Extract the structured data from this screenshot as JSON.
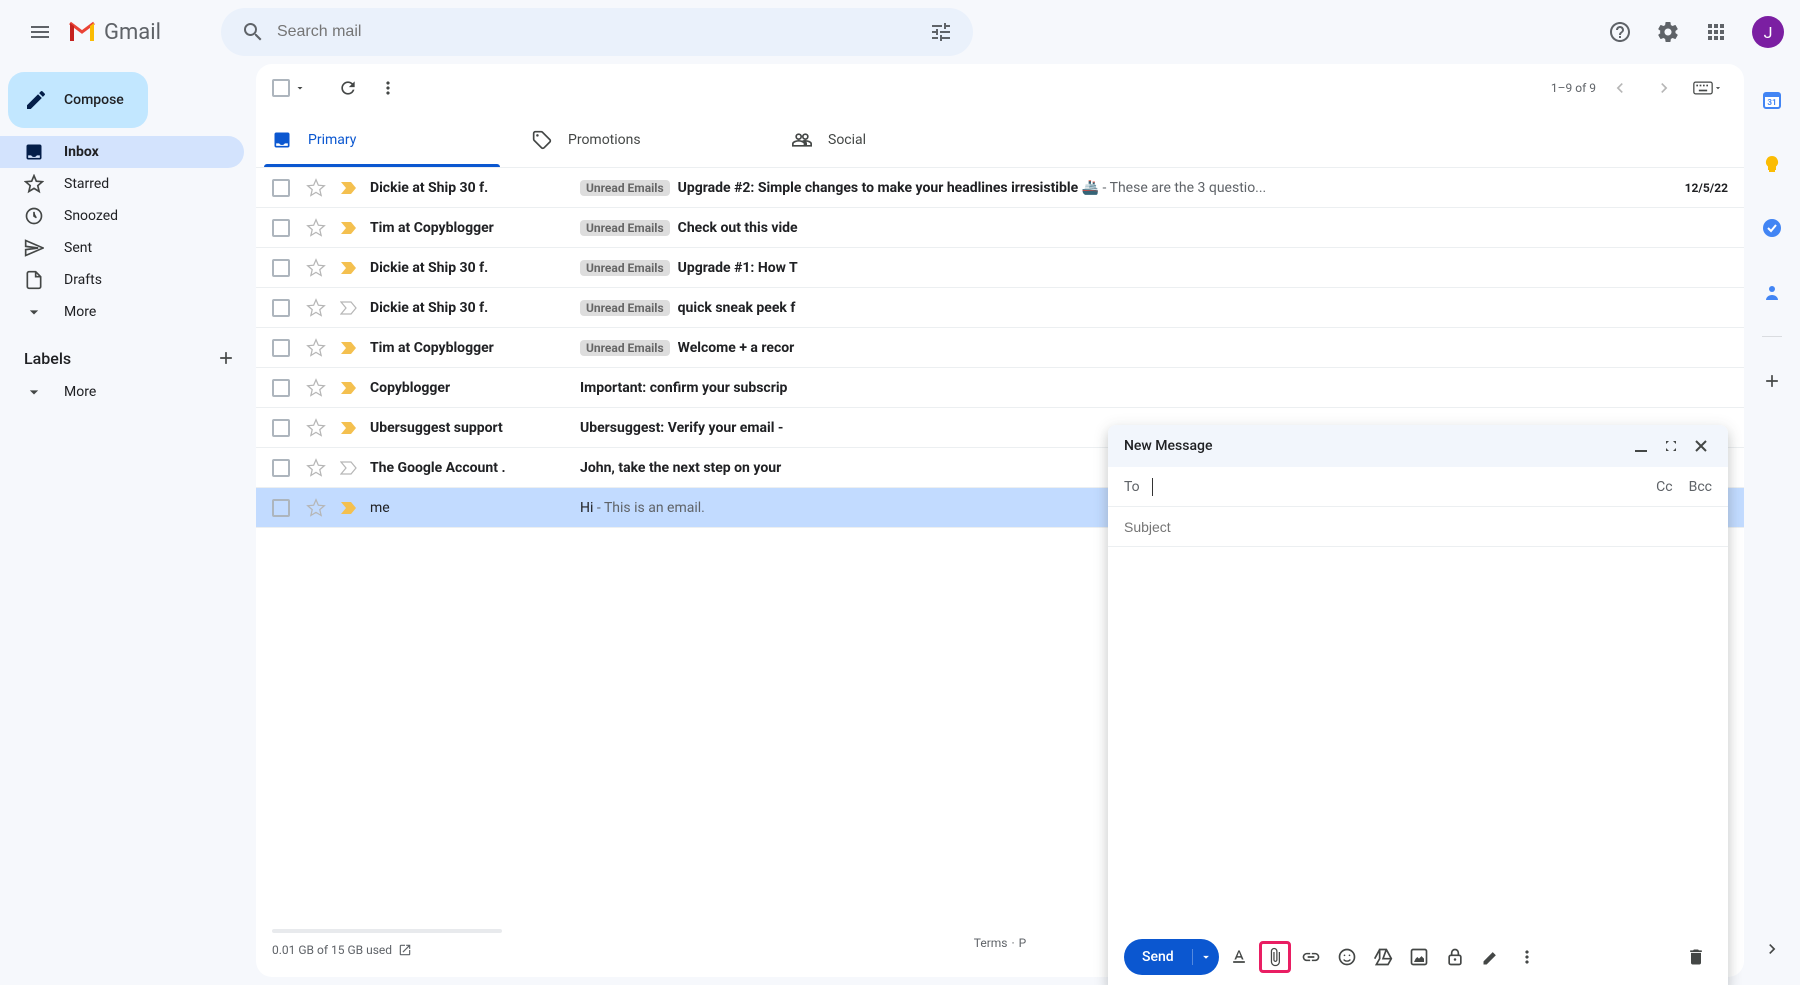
{
  "app_name": "Gmail",
  "search": {
    "placeholder": "Search mail"
  },
  "avatar_initial": "J",
  "compose_label": "Compose",
  "nav": {
    "inbox": "Inbox",
    "starred": "Starred",
    "snoozed": "Snoozed",
    "sent": "Sent",
    "drafts": "Drafts",
    "more": "More"
  },
  "labels_header": "Labels",
  "labels_more": "More",
  "pagination": "1–9 of 9",
  "tabs": {
    "primary": "Primary",
    "promotions": "Promotions",
    "social": "Social"
  },
  "label_tag": "Unread Emails",
  "rows": [
    {
      "sender": "Dickie at Ship 30 f.",
      "unread": true,
      "important": true,
      "has_label": true,
      "subject": "Upgrade #2: Simple changes to make your headlines irresistible 🚢",
      "snippet": " - These are the 3 questio...",
      "date": "12/5/22"
    },
    {
      "sender": "Tim at Copyblogger",
      "unread": true,
      "important": true,
      "has_label": true,
      "subject": "Check out this vide",
      "snippet": "",
      "date": ""
    },
    {
      "sender": "Dickie at Ship 30 f.",
      "unread": true,
      "important": true,
      "has_label": true,
      "subject": "Upgrade #1: How T",
      "snippet": "",
      "date": ""
    },
    {
      "sender": "Dickie at Ship 30 f.",
      "unread": true,
      "important": false,
      "has_label": true,
      "subject": "quick sneak peek f",
      "snippet": "",
      "date": ""
    },
    {
      "sender": "Tim at Copyblogger",
      "unread": true,
      "important": true,
      "has_label": true,
      "subject": "Welcome + a recor",
      "snippet": "",
      "date": ""
    },
    {
      "sender": "Copyblogger",
      "unread": true,
      "important": true,
      "has_label": false,
      "subject": "Important: confirm your subscrip",
      "snippet": "",
      "date": ""
    },
    {
      "sender": "Ubersuggest support",
      "unread": true,
      "important": true,
      "has_label": false,
      "subject": "Ubersuggest: Verify your email - ",
      "snippet": "",
      "date": ""
    },
    {
      "sender": "The Google Account .",
      "unread": true,
      "important": false,
      "has_label": false,
      "subject": "John, take the next step on your ",
      "snippet": "",
      "date": ""
    },
    {
      "sender": "me",
      "unread": false,
      "important": true,
      "has_label": false,
      "subject": "Hi",
      "snippet": " - This is an email.",
      "date": "",
      "me": true
    }
  ],
  "storage": "0.01 GB of 15 GB used",
  "footer_terms": "Terms",
  "footer_sep": "·",
  "footer_privacy": "P",
  "compose_window": {
    "title": "New Message",
    "to_label": "To",
    "cc": "Cc",
    "bcc": "Bcc",
    "subject_placeholder": "Subject",
    "send": "Send"
  }
}
